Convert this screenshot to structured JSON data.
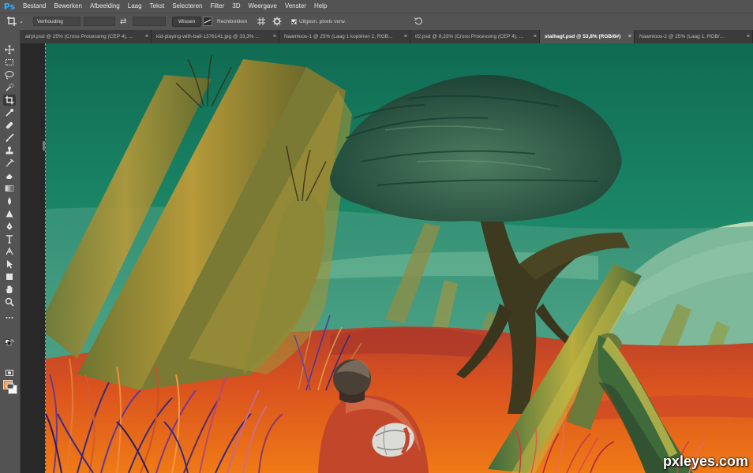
{
  "app": {
    "logo": "Ps"
  },
  "menu": [
    "Bestand",
    "Bewerken",
    "Afbeelding",
    "Laag",
    "Tekst",
    "Selecteren",
    "Filter",
    "3D",
    "Weergave",
    "Venster",
    "Help"
  ],
  "options": {
    "ratio_select": "Verhouding",
    "clear_button": "Wissen",
    "straighten_label": "Rechttrekken",
    "delete_pixels_label": "Uitgesn. pixels verw."
  },
  "tabs": [
    {
      "label": "airpl.psd @ 25% (Cross Processing (CEP 4), ...",
      "active": false
    },
    {
      "label": "kid-playing-with-ball-1376141.jpg @ 33,3% ...",
      "active": false
    },
    {
      "label": "Naamloos-1 @ 25% (Laag 1 kopiëren 2, RGB...",
      "active": false
    },
    {
      "label": "tf2.psd @ 8,33% (Cross Processing (CEP 4), ...",
      "active": false
    },
    {
      "label": "stalhagf.psd @ 53,8% (RGB/8#)",
      "active": true
    },
    {
      "label": "Naamloos-2 @ 25% (Laag 1, RGB/...",
      "active": false
    }
  ],
  "tab_close_glyph": "×",
  "colors": {
    "foreground": "#e87b27",
    "background": "#ffffff",
    "accent": "#31a8ff"
  },
  "tools": [
    "move-icon",
    "marquee-icon",
    "lasso-icon",
    "quick-select-icon",
    "crop-icon",
    "eyedropper-icon",
    "healing-icon",
    "brush-icon",
    "clone-stamp-icon",
    "history-brush-icon",
    "eraser-icon",
    "gradient-icon",
    "blur-icon",
    "dodge-icon",
    "pen-icon",
    "type-icon",
    "path-select-icon",
    "shape-icon",
    "hand-icon",
    "zoom-icon",
    "more-tools-icon"
  ],
  "watermark": "pxleyes.com"
}
